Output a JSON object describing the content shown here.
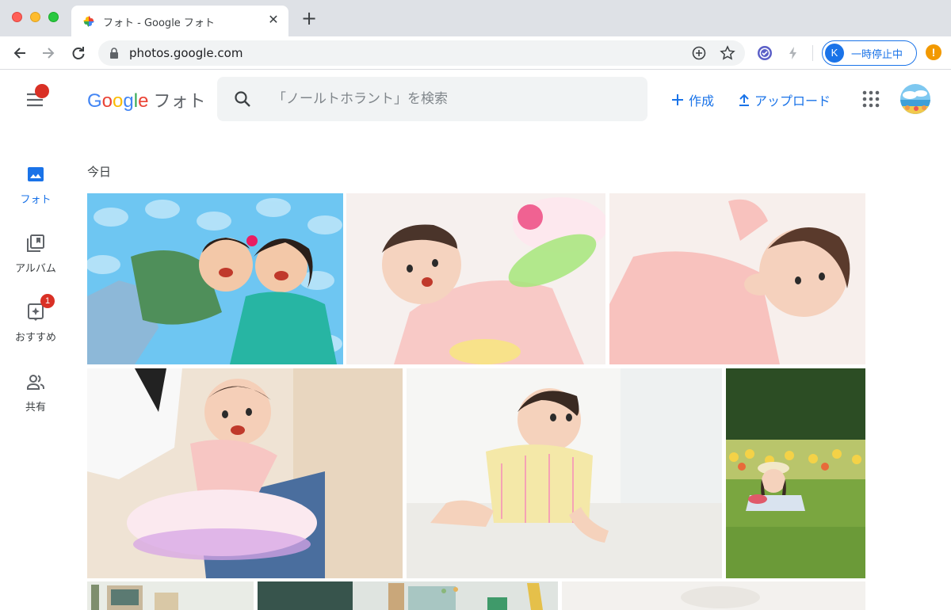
{
  "browser": {
    "tab_title": "フォト - Google フォト",
    "url": "photos.google.com",
    "profile_initial": "K",
    "profile_status": "一時停止中",
    "warning_symbol": "!"
  },
  "app": {
    "logo_letters": [
      "G",
      "o",
      "o",
      "g",
      "l",
      "e"
    ],
    "logo_suffix": "フォト",
    "search_placeholder": "「ノールトホラント」を検索",
    "create_label": "作成",
    "upload_label": "アップロード",
    "menu_badge": true
  },
  "sidebar": {
    "items": [
      {
        "label": "フォト",
        "icon": "photo-icon",
        "active": true
      },
      {
        "label": "アルバム",
        "icon": "album-icon",
        "active": false
      },
      {
        "label": "おすすめ",
        "icon": "assistant-icon",
        "active": false,
        "badge": "1"
      },
      {
        "label": "共有",
        "icon": "people-icon",
        "active": false
      }
    ]
  },
  "main": {
    "date_group": "今日",
    "photos": [
      {
        "subject": "two-kids-lying-on-cloud-blanket"
      },
      {
        "subject": "baby-in-pink-with-toy"
      },
      {
        "subject": "baby-in-pink-lying"
      },
      {
        "subject": "baby-in-tutu-held-by-parent"
      },
      {
        "subject": "baby-crawling"
      },
      {
        "subject": "girl-in-flower-field"
      },
      {
        "subject": "classroom-1"
      },
      {
        "subject": "classroom-2"
      },
      {
        "subject": "bright-room"
      }
    ]
  },
  "colors": {
    "accent": "#1a73e8",
    "badge": "#d93025",
    "warning": "#f29900"
  }
}
